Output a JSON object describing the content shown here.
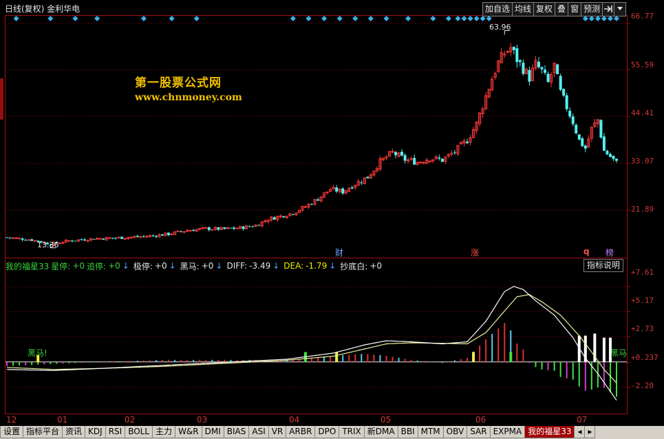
{
  "header": {
    "title": "日线(复权) 金利华电",
    "buttons": [
      "加自选",
      "均线",
      "复权",
      "叠",
      "窗",
      "预测"
    ],
    "icons": [
      "pin-right-icon",
      "chevron-down-icon"
    ]
  },
  "watermark": {
    "line1": "第一股票公式网",
    "line2": "www.chnmoney.com"
  },
  "price_axis": {
    "labels": [
      "66.77",
      "55.59",
      "44.41",
      "33.07",
      "21.89"
    ]
  },
  "price_annotations": {
    "high_label": "63.96",
    "low_label": "13.36",
    "markers": [
      "财",
      "涨",
      "q",
      "榜"
    ]
  },
  "indicator": {
    "name": "我的福星33",
    "fields": [
      {
        "label": "星停:",
        "value": "+0",
        "color": "green",
        "arrow": false
      },
      {
        "label": "追停:",
        "value": "+0",
        "color": "green",
        "arrow": true
      },
      {
        "label": "极停:",
        "value": "+0",
        "color": "white",
        "arrow": true
      },
      {
        "label": "黑马:",
        "value": "+0",
        "color": "white",
        "arrow": true
      },
      {
        "label": "DIFF:",
        "value": "-3.49",
        "color": "white",
        "arrow": true
      },
      {
        "label": "DEA:",
        "value": "-1.79",
        "color": "yellow",
        "arrow": true
      },
      {
        "label": "抄底白:",
        "value": "+0",
        "color": "white",
        "arrow": false
      }
    ],
    "explain_button": "指标说明",
    "axis_labels": [
      "+7.61",
      "+5.17",
      "+2.73",
      "+0.237",
      "-2.20"
    ],
    "annotations": [
      "黑马!",
      "黑马"
    ]
  },
  "time_axis": {
    "labels": [
      "12",
      "01",
      "02",
      "03",
      "04",
      "05",
      "06",
      "07"
    ]
  },
  "tabs": {
    "items": [
      "设置",
      "指标平台",
      "资讯",
      "KDJ",
      "RSI",
      "BOLL",
      "主力",
      "W&R",
      "DMI",
      "BIAS",
      "ASI",
      "VR",
      "ARBR",
      "DPO",
      "TRIX",
      "新DMA",
      "BBI",
      "MTM",
      "OBV",
      "SAR",
      "EXPMA",
      "我的福星33"
    ],
    "active": "我的福星33"
  },
  "chart_data": {
    "type": "candlestick",
    "title": "日线(复权) 金利华电",
    "price_ticks": [
      66.77,
      55.59,
      44.41,
      33.07,
      21.89
    ],
    "ylim": [
      10.5,
      68.5
    ],
    "months": [
      "12",
      "01",
      "02",
      "03",
      "04",
      "05",
      "06",
      "07"
    ],
    "highest": 63.96,
    "lowest": 13.36,
    "close_path": [
      [
        0,
        15.2
      ],
      [
        8,
        14.6
      ],
      [
        14,
        13.6
      ],
      [
        20,
        14.4
      ],
      [
        28,
        14.9
      ],
      [
        36,
        15.1
      ],
      [
        44,
        15.4
      ],
      [
        52,
        16.0
      ],
      [
        58,
        16.9
      ],
      [
        64,
        17.3
      ],
      [
        70,
        17.2
      ],
      [
        76,
        17.6
      ],
      [
        80,
        18.1
      ],
      [
        84,
        19.6
      ],
      [
        88,
        20.3
      ],
      [
        92,
        21.1
      ],
      [
        96,
        22.6
      ],
      [
        100,
        24.5
      ],
      [
        104,
        26.8
      ],
      [
        108,
        26.2
      ],
      [
        112,
        28.1
      ],
      [
        116,
        29.7
      ],
      [
        120,
        33.4
      ],
      [
        124,
        35.6
      ],
      [
        128,
        33.9
      ],
      [
        132,
        33.3
      ],
      [
        136,
        34.3
      ],
      [
        140,
        33.8
      ],
      [
        144,
        35.8
      ],
      [
        148,
        38.6
      ],
      [
        151,
        42.5
      ],
      [
        153,
        47.0
      ],
      [
        156,
        53.5
      ],
      [
        158,
        57.2
      ],
      [
        160,
        59.5
      ],
      [
        162,
        60.8
      ],
      [
        164,
        58.0
      ],
      [
        166,
        55.8
      ],
      [
        168,
        53.6
      ],
      [
        170,
        56.8
      ],
      [
        172,
        55.1
      ],
      [
        174,
        52.3
      ],
      [
        176,
        56.5
      ],
      [
        178,
        50.0
      ],
      [
        180,
        46.5
      ],
      [
        182,
        43.0
      ],
      [
        184,
        38.5
      ],
      [
        186,
        36.6
      ],
      [
        188,
        41.3
      ],
      [
        190,
        43.5
      ],
      [
        192,
        36.0
      ],
      [
        194,
        34.6
      ],
      [
        196,
        33.1
      ]
    ],
    "indicator": {
      "name": "我的福星33",
      "ticks": [
        7.61,
        5.17,
        2.73,
        0.237,
        -2.2
      ],
      "ylim": [
        -4.8,
        9.0
      ],
      "DIFF": [
        [
          0,
          -0.5
        ],
        [
          15,
          -0.6
        ],
        [
          30,
          -0.4
        ],
        [
          50,
          -0.1
        ],
        [
          70,
          0.2
        ],
        [
          90,
          0.5
        ],
        [
          105,
          1.1
        ],
        [
          115,
          1.9
        ],
        [
          122,
          2.3
        ],
        [
          130,
          2.2
        ],
        [
          140,
          2.0
        ],
        [
          148,
          2.2
        ],
        [
          154,
          4.2
        ],
        [
          160,
          7.1
        ],
        [
          163,
          7.6
        ],
        [
          166,
          7.3
        ],
        [
          170,
          6.2
        ],
        [
          176,
          4.8
        ],
        [
          182,
          2.6
        ],
        [
          186,
          0.6
        ],
        [
          190,
          -0.9
        ],
        [
          196,
          -3.5
        ]
      ],
      "DEA": [
        [
          0,
          -0.3
        ],
        [
          15,
          -0.5
        ],
        [
          30,
          -0.4
        ],
        [
          50,
          -0.2
        ],
        [
          70,
          0.1
        ],
        [
          90,
          0.4
        ],
        [
          105,
          0.8
        ],
        [
          115,
          1.5
        ],
        [
          122,
          2.0
        ],
        [
          130,
          2.1
        ],
        [
          140,
          2.05
        ],
        [
          148,
          2.0
        ],
        [
          154,
          3.1
        ],
        [
          160,
          5.2
        ],
        [
          164,
          6.6
        ],
        [
          168,
          6.8
        ],
        [
          172,
          6.1
        ],
        [
          178,
          4.8
        ],
        [
          184,
          2.8
        ],
        [
          188,
          1.2
        ],
        [
          192,
          -0.5
        ],
        [
          196,
          -1.8
        ]
      ]
    }
  }
}
